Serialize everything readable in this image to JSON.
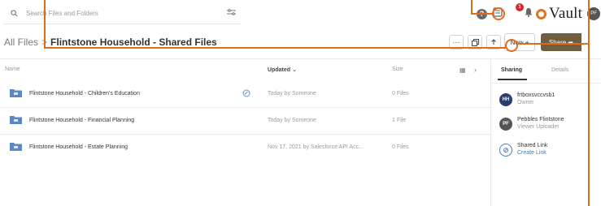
{
  "search": {
    "placeholder": "Search Files and Folders",
    "filter_icon": "filter-sliders-icon"
  },
  "header": {
    "brand_name": "Vault",
    "user_initials": "PF",
    "notification_count": "1",
    "help_icon": "question-icon",
    "inbox_icon": "inbox-icon",
    "bell_icon": "bell-icon"
  },
  "breadcrumb": {
    "root": "All Files",
    "separator": ">",
    "current": "Flintstone Household - Shared Files"
  },
  "toolbar": {
    "more_label": "···",
    "new_label": "New +",
    "share_label": "Share ➦"
  },
  "table": {
    "columns": {
      "name": "Name",
      "updated": "Updated ⌄",
      "size": "Size",
      "grid_icon": "▦",
      "chevron": "›"
    },
    "rows": [
      {
        "name": "Flintstone Household - Children's Education",
        "updated": "Today by Someone",
        "size": "0 Files",
        "synced": true
      },
      {
        "name": "Flintstone Household - Financial Planning",
        "updated": "Today by Someone",
        "size": "1 File",
        "synced": false
      },
      {
        "name": "Flintstone Household - Estate Planning",
        "updated": "Nov 17, 2021 by Salesforce API Acc...",
        "size": "0 Files",
        "synced": false
      }
    ]
  },
  "panel": {
    "tabs": {
      "sharing": "Sharing",
      "details": "Details"
    },
    "entries": [
      {
        "initials": "HH",
        "name": "frtboxsvccvsb1",
        "role": "Owner"
      },
      {
        "initials": "PF",
        "name": "Pebbles Flintstone",
        "role": "Viewer Uploader"
      }
    ],
    "shared_link": {
      "title": "Shared Link",
      "action": "Create Link"
    }
  },
  "colors": {
    "accent": "#e06b1b",
    "share_button": "#6e5e3f",
    "brand_ring": "#e77319",
    "owner_avatar": "#2c3e70",
    "link": "#3d7bc6",
    "folder": "#5d86c5"
  }
}
